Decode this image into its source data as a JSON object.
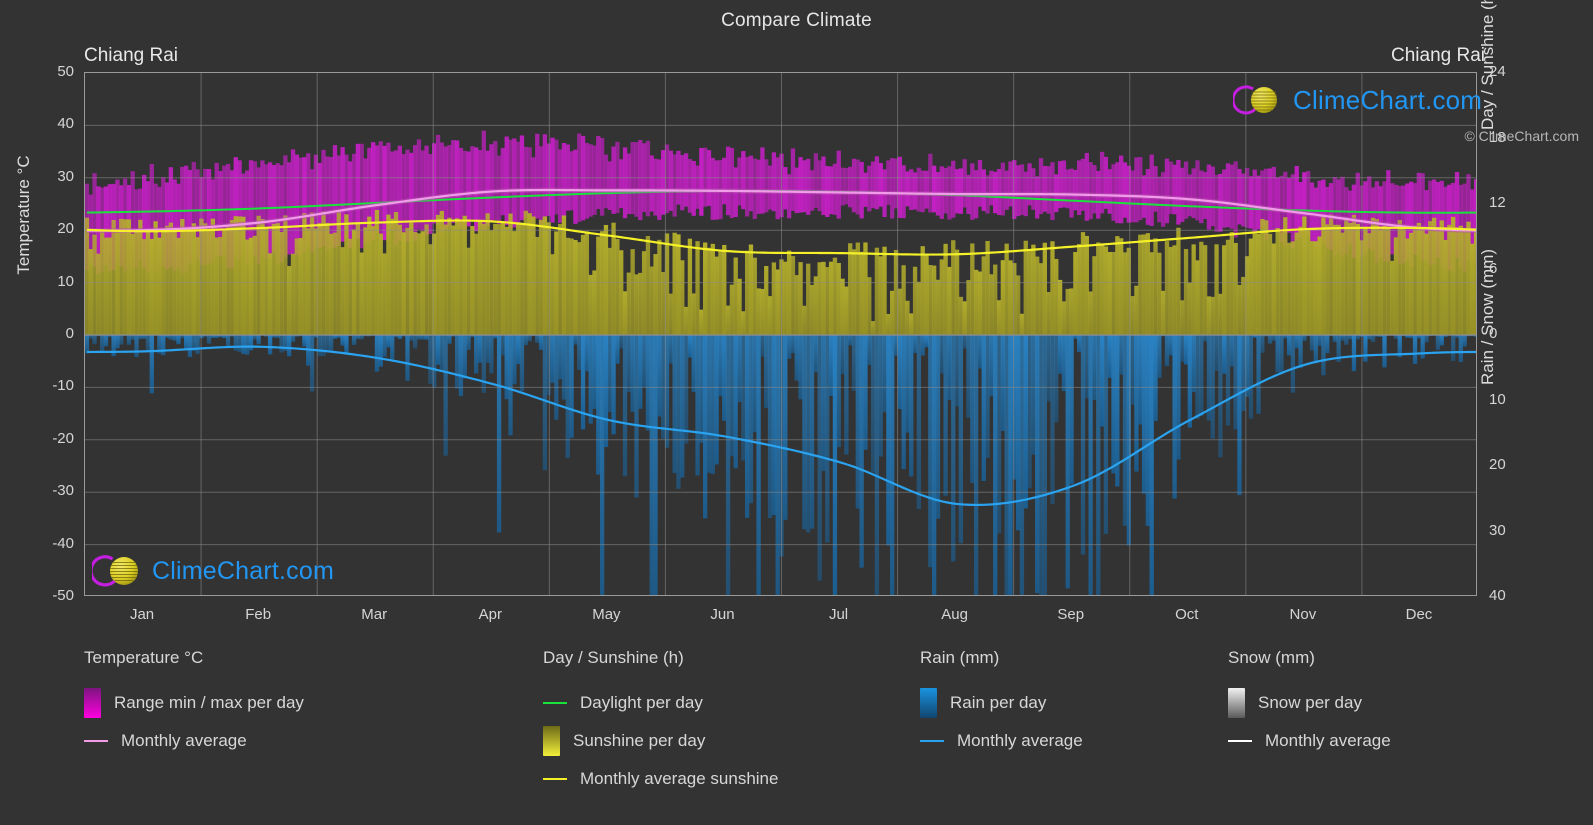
{
  "header": {
    "title": "Compare Climate",
    "location_left": "Chiang Rai",
    "location_right": "Chiang Rai"
  },
  "axes": {
    "left_title": "Temperature °C",
    "right_title_top": "Day / Sunshine (h)",
    "right_title_bottom": "Rain / Snow (mm)",
    "y_left_ticks": [
      "50",
      "40",
      "30",
      "20",
      "10",
      "0",
      "-10",
      "-20",
      "-30",
      "-40",
      "-50"
    ],
    "y_right_top_ticks": [
      "24",
      "18",
      "12",
      "6",
      "0"
    ],
    "y_right_bottom_ticks": [
      "0",
      "10",
      "20",
      "30",
      "40"
    ],
    "x_ticks": [
      "Jan",
      "Feb",
      "Mar",
      "Apr",
      "May",
      "Jun",
      "Jul",
      "Aug",
      "Sep",
      "Oct",
      "Nov",
      "Dec"
    ]
  },
  "legend": {
    "columns": [
      {
        "heading": "Temperature °C",
        "items": [
          {
            "label": "Range min / max per day",
            "marker": "swatch",
            "color": "#ff00e0"
          },
          {
            "label": "Monthly average",
            "marker": "line",
            "color": "#f49be8"
          }
        ]
      },
      {
        "heading": "Day / Sunshine (h)",
        "items": [
          {
            "label": "Daylight per day",
            "marker": "line",
            "color": "#19e33b"
          },
          {
            "label": "Sunshine per day",
            "marker": "swatch",
            "color": "#f2ef3a"
          },
          {
            "label": "Monthly average sunshine",
            "marker": "line",
            "color": "#f5f128"
          }
        ]
      },
      {
        "heading": "Rain (mm)",
        "items": [
          {
            "label": "Rain per day",
            "marker": "swatch",
            "color": "#1a8fd8"
          },
          {
            "label": "Monthly average",
            "marker": "line",
            "color": "#28a3ef"
          }
        ]
      },
      {
        "heading": "Snow (mm)",
        "items": [
          {
            "label": "Snow per day",
            "marker": "swatch",
            "color": "#e8e8e8"
          },
          {
            "label": "Monthly average",
            "marker": "line",
            "color": "#ffffff"
          }
        ]
      }
    ],
    "copyright": "© ClimeChart.com"
  },
  "watermark": {
    "text": "ClimeChart.com"
  },
  "colors": {
    "background": "#333333",
    "grid": "#8c8c8c",
    "temp_range": "#cc1fcc",
    "temp_avg": "#f29bea",
    "daylight": "#19e33b",
    "sunshine_area": "#a8a52a",
    "sunshine_avg": "#f5f128",
    "rain_area": "#1c74b8",
    "rain_avg": "#2aa3f0",
    "logo_arc": "#c41fe0",
    "logo_sphere": "#d4c41a",
    "logo_text": "#2196f3"
  },
  "chart_data": {
    "type": "area",
    "title": "Compare Climate",
    "subtitle": "Chiang Rai",
    "xlabel": "",
    "ylabel": "Temperature °C",
    "ylim": [
      -50,
      50
    ],
    "y2lim_day": [
      0,
      24
    ],
    "y2lim_rain": [
      0,
      40
    ],
    "grid": true,
    "legend_position": "bottom",
    "categories": [
      "Jan",
      "Feb",
      "Mar",
      "Apr",
      "May",
      "Jun",
      "Jul",
      "Aug",
      "Sep",
      "Oct",
      "Nov",
      "Dec"
    ],
    "series": [
      {
        "name": "Monthly average temperature (°C)",
        "unit": "°C",
        "color": "#f29bea",
        "values": [
          20.0,
          21.5,
          24.8,
          27.4,
          27.6,
          27.5,
          27.2,
          26.9,
          26.8,
          25.9,
          23.2,
          20.4
        ]
      },
      {
        "name": "Daily max temperature range top (°C)",
        "unit": "°C",
        "color": "#cc1fcc",
        "values": [
          30.0,
          32.5,
          35.5,
          36.8,
          35.5,
          33.8,
          32.8,
          32.5,
          32.8,
          32.2,
          30.5,
          28.8
        ]
      },
      {
        "name": "Daily min temperature range bottom (°C)",
        "unit": "°C",
        "color": "#cc1fcc",
        "values": [
          13.0,
          14.5,
          18.0,
          21.5,
          23.0,
          23.5,
          23.5,
          23.4,
          23.0,
          21.5,
          17.5,
          13.8
        ]
      },
      {
        "name": "Daylight per day (h)",
        "unit": "h",
        "color": "#19e33b",
        "values": [
          11.3,
          11.6,
          12.1,
          12.6,
          13.0,
          13.2,
          13.1,
          12.8,
          12.3,
          11.8,
          11.4,
          11.2
        ]
      },
      {
        "name": "Monthly average sunshine (h)",
        "unit": "h",
        "color": "#f5f128",
        "values": [
          9.5,
          9.8,
          10.3,
          10.4,
          9.1,
          7.7,
          7.5,
          7.4,
          8.1,
          8.9,
          9.7,
          9.8
        ]
      },
      {
        "name": "Monthly average rain (mm)",
        "unit": "mm",
        "color": "#2aa3f0",
        "values": [
          2.5,
          1.8,
          3.5,
          7.5,
          13.0,
          15.5,
          19.5,
          25.8,
          23.0,
          13.0,
          4.5,
          2.8
        ]
      },
      {
        "name": "Monthly average snow (mm)",
        "unit": "mm",
        "color": "#ffffff",
        "values": [
          0,
          0,
          0,
          0,
          0,
          0,
          0,
          0,
          0,
          0,
          0,
          0
        ]
      }
    ]
  }
}
